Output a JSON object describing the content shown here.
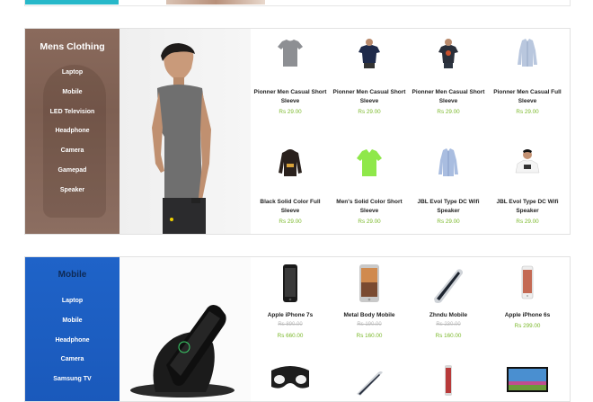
{
  "mens": {
    "title": "Mens Clothing",
    "menu": [
      "Laptop",
      "Mobile",
      "LED Television",
      "Headphone",
      "Camera",
      "Gamepad",
      "Speaker"
    ],
    "products": [
      {
        "name": "Pionner Men Casual Short Sleeve",
        "price": "Rs 29.00",
        "icon": "grey-tshirt-icon"
      },
      {
        "name": "Pionner Men Casual Short Sleeve",
        "price": "Rs 29.00",
        "icon": "navy-tshirt-icon"
      },
      {
        "name": "Pionner Men Casual Short Sleeve",
        "price": "Rs 29.00",
        "icon": "printed-tshirt-icon"
      },
      {
        "name": "Pionner Men Casual Full Sleeve",
        "price": "Rs 29.00",
        "icon": "shirt-icon"
      },
      {
        "name": "Black Solid Color Full Sleeve",
        "price": "Rs 29.00",
        "icon": "hoodie-icon"
      },
      {
        "name": "Men's Solid Color Short Sleeve",
        "price": "Rs 29.00",
        "icon": "green-polo-icon"
      },
      {
        "name": "JBL Evol Type DC Wifi Speaker",
        "price": "Rs 29.00",
        "icon": "blue-shirt-icon"
      },
      {
        "name": "JBL Evol Type DC Wifi Speaker",
        "price": "Rs 29.00",
        "icon": "model-tshirt-icon"
      }
    ]
  },
  "mobile": {
    "title": "Mobile",
    "menu": [
      "Laptop",
      "Mobile",
      "Headphone",
      "Camera",
      "Samsung TV"
    ],
    "products": [
      {
        "name": "Apple iPhone 7s",
        "old_price": "Rs 890.00",
        "price": "Rs 660.00",
        "icon": "phone-icon"
      },
      {
        "name": "Metal Body Mobile",
        "old_price": "Rs 190.00",
        "price": "Rs 160.00",
        "icon": "tablet-icon"
      },
      {
        "name": "Zhndu Mobile",
        "old_price": "Rs 230.00",
        "price": "Rs 160.00",
        "icon": "angled-phone-icon"
      },
      {
        "name": "Apple iPhone 6s",
        "old_price": "",
        "price": "Rs 299.00",
        "icon": "white-phone-icon"
      }
    ]
  },
  "colors": {
    "accent_green": "#7ab829",
    "mens_side": "#8a6a5c",
    "mobile_side": "#1f63c8",
    "top_teal": "#27b8c9"
  }
}
